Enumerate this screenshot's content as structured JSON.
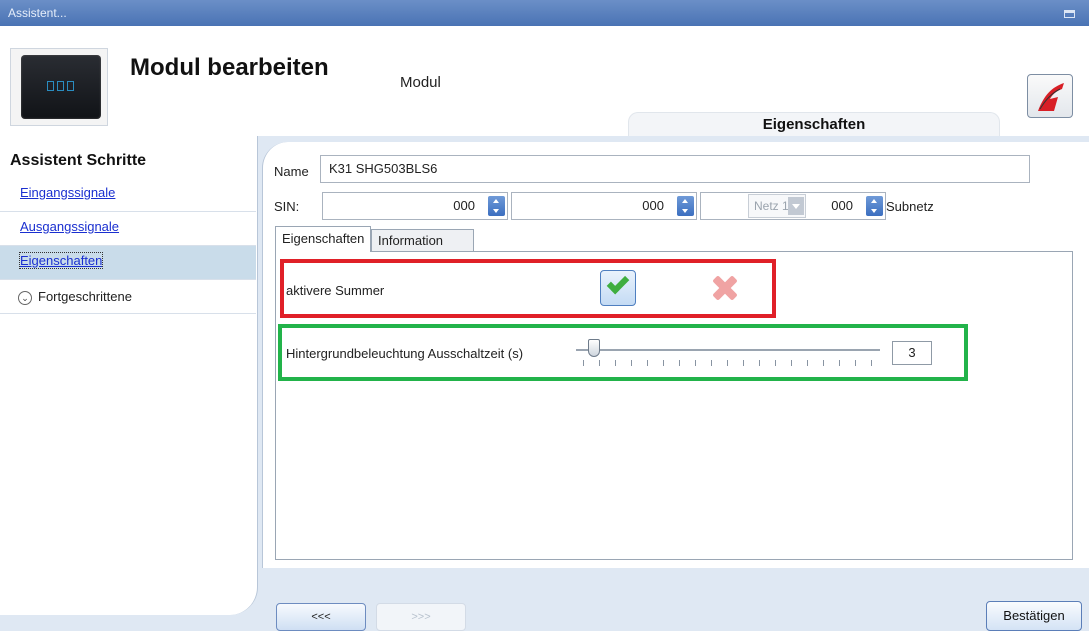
{
  "window": {
    "title": "Assistent..."
  },
  "header": {
    "title": "Modul bearbeiten",
    "subtitle": "Modul",
    "section_tab": "Eigenschaften"
  },
  "sidebar": {
    "title": "Assistent Schritte",
    "items": [
      {
        "label": "Eingangssignale"
      },
      {
        "label": "Ausgangssignale"
      },
      {
        "label": "Eigenschaften"
      },
      {
        "label": "Fortgeschrittene"
      }
    ]
  },
  "form": {
    "name_label": "Name",
    "name_value": "K31 SHG503BLS6",
    "sin_label": "SIN:",
    "sin_values": [
      "000",
      "000",
      "000"
    ],
    "subnet_label": "Subnetz",
    "subnet_value": "Netz 1"
  },
  "tabs": [
    "Eigenschaften",
    "Information"
  ],
  "properties": {
    "buzzer_label": "aktivere Summer",
    "backlight_label": "Hintergrundbeleuchtung Ausschaltzeit (s)",
    "backlight_value": "3",
    "slider_fraction": 0.06
  },
  "buttons": {
    "back": "<<<",
    "next": ">>>",
    "confirm": "Bestätigen"
  },
  "colors": {
    "highlight_red": "#e02028",
    "highlight_green": "#22b34a",
    "accent": "#4a73b4"
  }
}
